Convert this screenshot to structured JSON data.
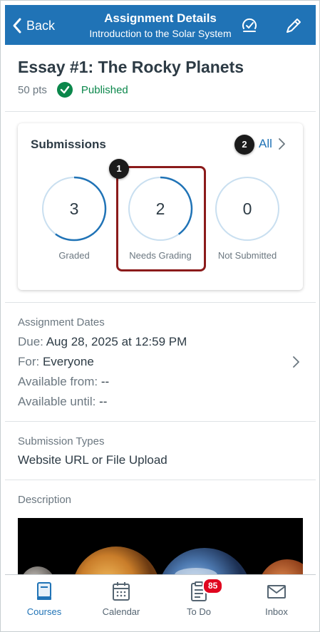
{
  "header": {
    "back_label": "Back",
    "title": "Assignment Details",
    "subtitle": "Introduction to the Solar System",
    "color": "#2073b6"
  },
  "assignment": {
    "name": "Essay #1: The Rocky Planets",
    "points": "50 pts",
    "status": "Published",
    "status_color": "#0b874b"
  },
  "submissions": {
    "title": "Submissions",
    "all_label": "All",
    "stats": [
      {
        "count": "3",
        "label": "Graded",
        "progress": 0.6
      },
      {
        "count": "2",
        "label": "Needs Grading",
        "progress": 0.4
      },
      {
        "count": "0",
        "label": "Not Submitted",
        "progress": 0
      }
    ],
    "callouts": [
      "1",
      "2"
    ]
  },
  "dates": {
    "section_label": "Assignment Dates",
    "due_key": "Due:",
    "due_value": "Aug 28, 2025 at 12:59 PM",
    "for_key": "For:",
    "for_value": "Everyone",
    "available_from_key": "Available from:",
    "available_from_value": "--",
    "available_until_key": "Available until:",
    "available_until_value": "--"
  },
  "submission_types": {
    "section_label": "Submission Types",
    "value": "Website URL or File Upload"
  },
  "description": {
    "section_label": "Description"
  },
  "tabs": [
    {
      "label": "Courses",
      "icon": "courses-icon",
      "active": true
    },
    {
      "label": "Calendar",
      "icon": "calendar-icon",
      "active": false
    },
    {
      "label": "To Do",
      "icon": "todo-icon",
      "active": false,
      "badge": "85"
    },
    {
      "label": "Inbox",
      "icon": "inbox-icon",
      "active": false
    }
  ]
}
